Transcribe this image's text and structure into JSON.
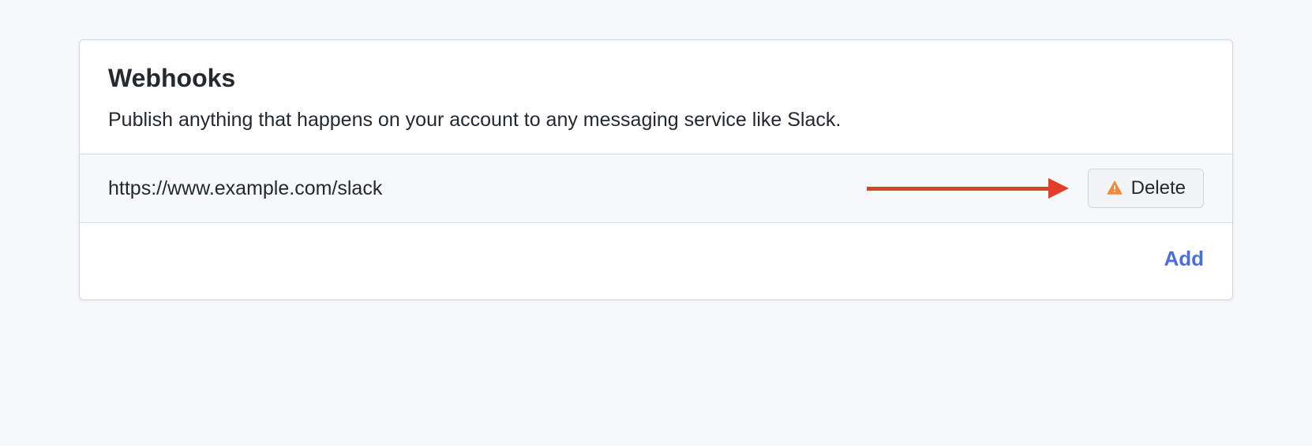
{
  "panel": {
    "title": "Webhooks",
    "description": "Publish anything that happens on your account to any messaging service like Slack."
  },
  "webhooks": [
    {
      "url": "https://www.example.com/slack",
      "delete_label": "Delete"
    }
  ],
  "footer": {
    "add_label": "Add"
  }
}
